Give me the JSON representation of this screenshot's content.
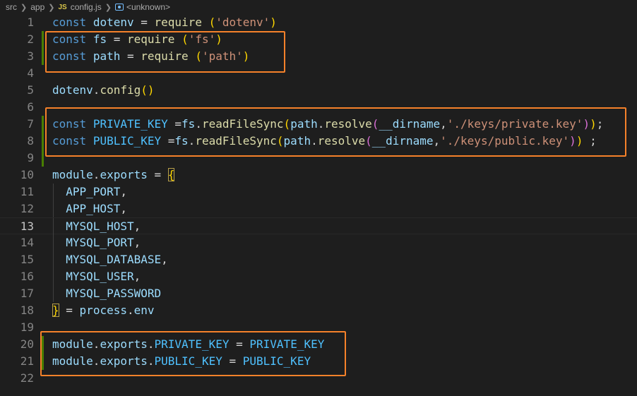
{
  "breadcrumb": {
    "folder1": "src",
    "folder2": "app",
    "file_icon": "JS",
    "file": "config.js",
    "symbol": "<unknown>"
  },
  "lines": [
    {
      "n": "1",
      "t": [
        [
          "kw",
          "const"
        ],
        [
          "op",
          " "
        ],
        [
          "var",
          "dotenv"
        ],
        [
          "op",
          " = "
        ],
        [
          "fn",
          "require"
        ],
        [
          "op",
          " "
        ],
        [
          "p1",
          "("
        ],
        [
          "str",
          "'dotenv'"
        ],
        [
          "p1",
          ")"
        ]
      ]
    },
    {
      "n": "2",
      "t": [
        [
          "kw",
          "const"
        ],
        [
          "op",
          " "
        ],
        [
          "var",
          "fs"
        ],
        [
          "op",
          " = "
        ],
        [
          "fn",
          "require"
        ],
        [
          "op",
          " "
        ],
        [
          "p1",
          "("
        ],
        [
          "str",
          "'fs'"
        ],
        [
          "p1",
          ")"
        ]
      ]
    },
    {
      "n": "3",
      "t": [
        [
          "kw",
          "const"
        ],
        [
          "op",
          " "
        ],
        [
          "var",
          "path"
        ],
        [
          "op",
          " = "
        ],
        [
          "fn",
          "require"
        ],
        [
          "op",
          " "
        ],
        [
          "p1",
          "("
        ],
        [
          "str",
          "'path'"
        ],
        [
          "p1",
          ")"
        ]
      ]
    },
    {
      "n": "4",
      "t": []
    },
    {
      "n": "5",
      "t": [
        [
          "var",
          "dotenv"
        ],
        [
          "op",
          "."
        ],
        [
          "fn",
          "config"
        ],
        [
          "p1",
          "()"
        ]
      ]
    },
    {
      "n": "6",
      "t": []
    },
    {
      "n": "7",
      "t": [
        [
          "kw",
          "const"
        ],
        [
          "op",
          " "
        ],
        [
          "const",
          "PRIVATE_KEY"
        ],
        [
          "op",
          " ="
        ],
        [
          "var",
          "fs"
        ],
        [
          "op",
          "."
        ],
        [
          "fn",
          "readFileSync"
        ],
        [
          "p1",
          "("
        ],
        [
          "var",
          "path"
        ],
        [
          "op",
          "."
        ],
        [
          "fn",
          "resolve"
        ],
        [
          "p2",
          "("
        ],
        [
          "var",
          "__dirname"
        ],
        [
          "op",
          ","
        ],
        [
          "str",
          "'./keys/private.key'"
        ],
        [
          "p2",
          ")"
        ],
        [
          "p1",
          ")"
        ],
        [
          "op",
          ";"
        ]
      ]
    },
    {
      "n": "8",
      "t": [
        [
          "kw",
          "const"
        ],
        [
          "op",
          " "
        ],
        [
          "const",
          "PUBLIC_KEY"
        ],
        [
          "op",
          " ="
        ],
        [
          "var",
          "fs"
        ],
        [
          "op",
          "."
        ],
        [
          "fn",
          "readFileSync"
        ],
        [
          "p1",
          "("
        ],
        [
          "var",
          "path"
        ],
        [
          "op",
          "."
        ],
        [
          "fn",
          "resolve"
        ],
        [
          "p2",
          "("
        ],
        [
          "var",
          "__dirname"
        ],
        [
          "op",
          ","
        ],
        [
          "str",
          "'./keys/public.key'"
        ],
        [
          "p2",
          ")"
        ],
        [
          "p1",
          ")"
        ],
        [
          "op",
          " ;"
        ]
      ]
    },
    {
      "n": "9",
      "t": []
    },
    {
      "n": "10",
      "t": [
        [
          "var",
          "module"
        ],
        [
          "op",
          "."
        ],
        [
          "var",
          "exports"
        ],
        [
          "op",
          " = "
        ],
        [
          "p1b",
          "{"
        ]
      ]
    },
    {
      "n": "11",
      "t": [
        [
          "op",
          "  "
        ],
        [
          "var",
          "APP_PORT"
        ],
        [
          "op",
          ","
        ]
      ]
    },
    {
      "n": "12",
      "t": [
        [
          "op",
          "  "
        ],
        [
          "var",
          "APP_HOST"
        ],
        [
          "op",
          ","
        ]
      ]
    },
    {
      "n": "13",
      "t": [
        [
          "op",
          "  "
        ],
        [
          "var",
          "MYSQL_HOST"
        ],
        [
          "op",
          ","
        ]
      ]
    },
    {
      "n": "14",
      "t": [
        [
          "op",
          "  "
        ],
        [
          "var",
          "MYSQL_PORT"
        ],
        [
          "op",
          ","
        ]
      ]
    },
    {
      "n": "15",
      "t": [
        [
          "op",
          "  "
        ],
        [
          "var",
          "MYSQL_DATABASE"
        ],
        [
          "op",
          ","
        ]
      ]
    },
    {
      "n": "16",
      "t": [
        [
          "op",
          "  "
        ],
        [
          "var",
          "MYSQL_USER"
        ],
        [
          "op",
          ","
        ]
      ]
    },
    {
      "n": "17",
      "t": [
        [
          "op",
          "  "
        ],
        [
          "var",
          "MYSQL_PASSWORD"
        ]
      ]
    },
    {
      "n": "18",
      "t": [
        [
          "p1b",
          "}"
        ],
        [
          "op",
          " = "
        ],
        [
          "var",
          "process"
        ],
        [
          "op",
          "."
        ],
        [
          "var",
          "env"
        ]
      ]
    },
    {
      "n": "19",
      "t": []
    },
    {
      "n": "20",
      "t": [
        [
          "var",
          "module"
        ],
        [
          "op",
          "."
        ],
        [
          "var",
          "exports"
        ],
        [
          "op",
          "."
        ],
        [
          "const",
          "PRIVATE_KEY"
        ],
        [
          "op",
          " = "
        ],
        [
          "const",
          "PRIVATE_KEY"
        ]
      ]
    },
    {
      "n": "21",
      "t": [
        [
          "var",
          "module"
        ],
        [
          "op",
          "."
        ],
        [
          "var",
          "exports"
        ],
        [
          "op",
          "."
        ],
        [
          "const",
          "PUBLIC_KEY"
        ],
        [
          "op",
          " = "
        ],
        [
          "const",
          "PUBLIC_KEY"
        ]
      ]
    },
    {
      "n": "22",
      "t": []
    }
  ],
  "current_line": "13",
  "modified_lines": [
    "2",
    "3",
    "7",
    "8",
    "9",
    "20",
    "21"
  ],
  "indented_lines": [
    "11",
    "12",
    "13",
    "14",
    "15",
    "16",
    "17"
  ],
  "colors": {
    "background": "#1e1e1e",
    "keyword": "#569cd6",
    "variable": "#9cdcfe",
    "function": "#dcdcaa",
    "string": "#ce9178",
    "constant": "#4fc1ff",
    "highlight_box": "#f5812a",
    "gutter_modified": "#487e02"
  }
}
